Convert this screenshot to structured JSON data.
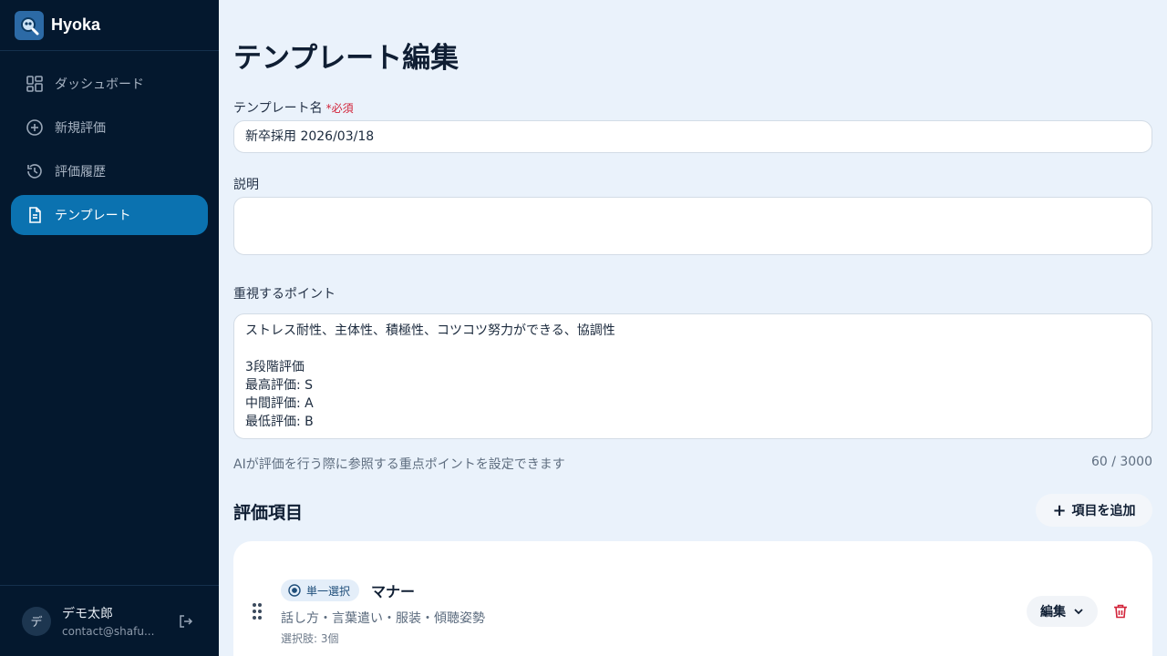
{
  "brand": {
    "name": "Hyoka"
  },
  "sidebar": {
    "items": [
      {
        "label": "ダッシュボード",
        "icon": "dashboard-icon"
      },
      {
        "label": "新規評価",
        "icon": "plus-circle-icon"
      },
      {
        "label": "評価履歴",
        "icon": "history-icon"
      },
      {
        "label": "テンプレート",
        "icon": "document-icon",
        "active": true
      }
    ]
  },
  "user": {
    "avatar_initial": "デ",
    "name": "デモ太郎",
    "email": "contact@shafu..."
  },
  "page": {
    "title": "テンプレート編集"
  },
  "form": {
    "name_label": "テンプレート名",
    "required_mark": "*必須",
    "name_value": "新卒採用 2026/03/18",
    "description_label": "説明",
    "description_value": "",
    "points_label": "重視するポイント",
    "points_value": "ストレス耐性、主体性、積極性、コツコツ努力ができる、協調性\n\n3段階評価\n最高評価: S\n中間評価: A\n最低評価: B",
    "points_hint": "AIが評価を行う際に参照する重点ポイントを設定できます",
    "points_counter": "60 / 3000"
  },
  "criteria": {
    "title": "評価項目",
    "add_label": "項目を追加",
    "items": [
      {
        "type_label": "単一選択",
        "name": "マナー",
        "description": "話し方・言葉遣い・服装・傾聴姿勢",
        "choices": "選択肢: 3個",
        "edit_label": "編集"
      }
    ]
  },
  "colors": {
    "sidebar_bg": "#04182e",
    "active": "#0b72b0",
    "page_bg": "#eaf2fb",
    "required": "#d2243a",
    "delete": "#d2243a"
  }
}
